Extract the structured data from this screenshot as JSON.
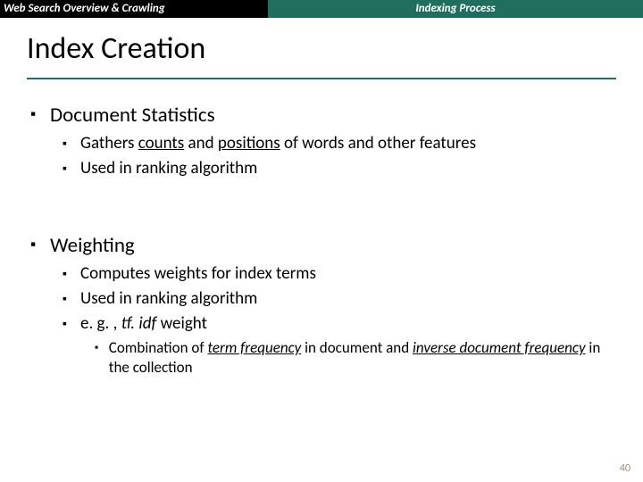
{
  "header": {
    "left": "Web Search Overview & Crawling",
    "right": "Indexing Process"
  },
  "title": "Index Creation",
  "sections": {
    "docstats": {
      "heading": "Document Statistics",
      "b1a": "Gathers ",
      "b1b": "counts",
      "b1c": " and ",
      "b1d": "positions",
      "b1e": " of words and other features",
      "b2": "Used in ranking algorithm"
    },
    "weighting": {
      "heading": "Weighting",
      "b1": "Computes weights for index terms",
      "b2": "Used in ranking algorithm",
      "b3a": "e. g. , ",
      "b3b": "tf. idf",
      "b3c": " weight",
      "sub_a": "Combination of ",
      "sub_b": "term frequency",
      "sub_c": " in document and ",
      "sub_d": "inverse document frequency",
      "sub_e": " in the collection"
    }
  },
  "page_number": "40",
  "glyphs": {
    "square": "▪"
  }
}
